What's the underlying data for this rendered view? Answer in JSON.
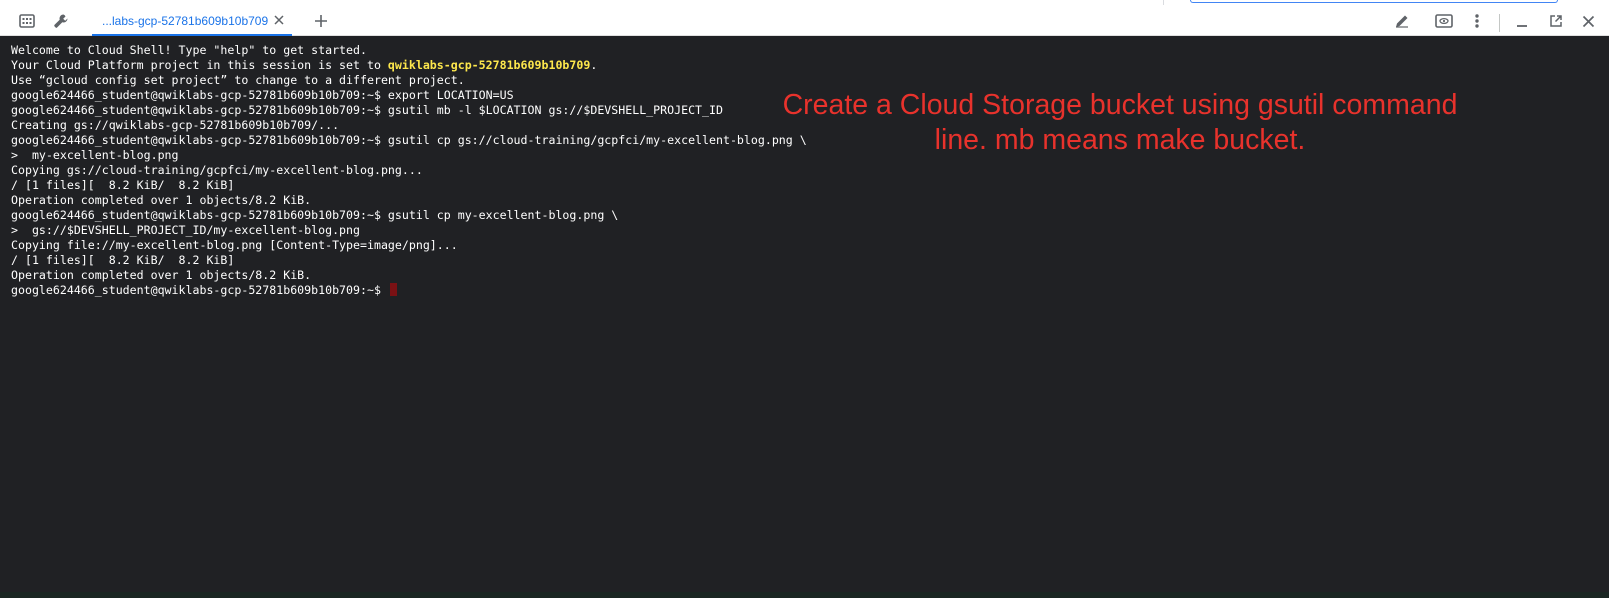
{
  "toolbar": {
    "tab": {
      "label": "...labs-gcp-52781b609b10b709"
    },
    "icons_left": [
      "keyboard-icon",
      "wrench-icon"
    ],
    "icons_right": [
      "pencil-icon",
      "web-preview-icon",
      "more-vert-icon",
      "minimize-icon",
      "open-new-window-icon",
      "close-icon"
    ]
  },
  "terminal": {
    "lines": [
      "Welcome to Cloud Shell! Type \"help\" to get started.",
      "Your Cloud Platform project in this session is set to ",
      "Use “gcloud config set project” to change to a different project.",
      "google624466_student@qwiklabs-gcp-52781b609b10b709:~$ export LOCATION=US",
      "google624466_student@qwiklabs-gcp-52781b609b10b709:~$ gsutil mb -l $LOCATION gs://$DEVSHELL_PROJECT_ID",
      "Creating gs://qwiklabs-gcp-52781b609b10b709/...",
      "google624466_student@qwiklabs-gcp-52781b609b10b709:~$ gsutil cp gs://cloud-training/gcpfci/my-excellent-blog.png \\",
      ">  my-excellent-blog.png",
      "Copying gs://cloud-training/gcpfci/my-excellent-blog.png...",
      "/ [1 files][  8.2 KiB/  8.2 KiB]",
      "Operation completed over 1 objects/8.2 KiB.",
      "google624466_student@qwiklabs-gcp-52781b609b10b709:~$ gsutil cp my-excellent-blog.png \\",
      ">  gs://$DEVSHELL_PROJECT_ID/my-excellent-blog.png",
      "Copying file://my-excellent-blog.png [Content-Type=image/png]...",
      "/ [1 files][  8.2 KiB/  8.2 KiB]",
      "Operation completed over 1 objects/8.2 KiB.",
      "google624466_student@qwiklabs-gcp-52781b609b10b709:~$ "
    ],
    "project_highlight": "qwiklabs-gcp-52781b609b10b709",
    "project_suffix": ".",
    "highlight_color": "#fde74c",
    "cursor_color": "#7a1114"
  },
  "annotation": {
    "line1": "Create a Cloud Storage bucket using gsutil command",
    "line2": "line. mb means make bucket.",
    "color": "#e8322c"
  }
}
